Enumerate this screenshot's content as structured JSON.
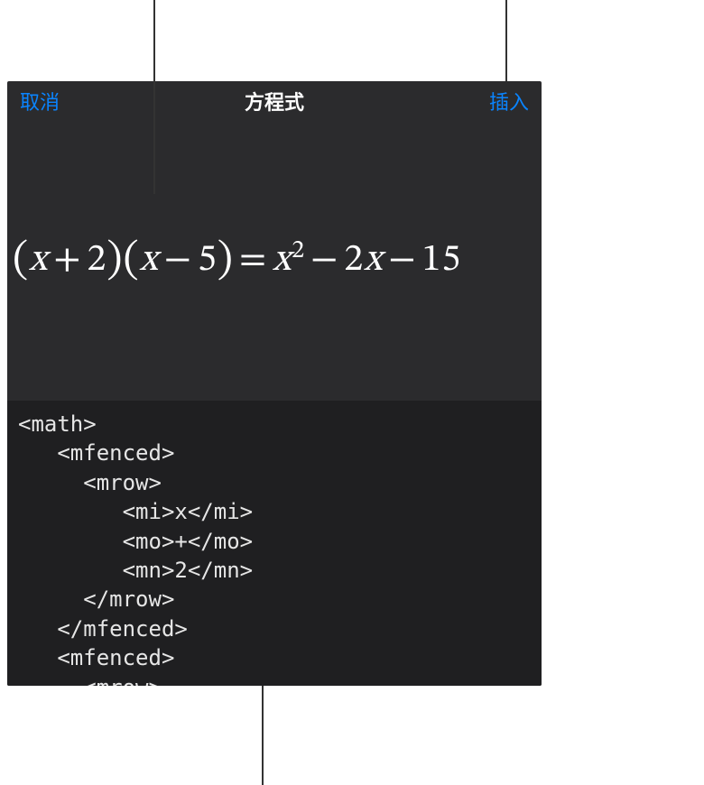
{
  "header": {
    "cancel_label": "取消",
    "title": "方程式",
    "insert_label": "插入"
  },
  "preview": {
    "paren_open": "(",
    "paren_close": ")",
    "x": "x",
    "plus": "+",
    "minus": "−",
    "equals": "=",
    "two": "2",
    "five": "5",
    "fifteen": "15",
    "exp2": "2"
  },
  "code": {
    "source": "<math>\n   <mfenced>\n     <mrow>\n        <mi>x</mi>\n        <mo>+</mo>\n        <mn>2</mn>\n     </mrow>\n   </mfenced>\n   <mfenced>\n     <mrow>"
  }
}
